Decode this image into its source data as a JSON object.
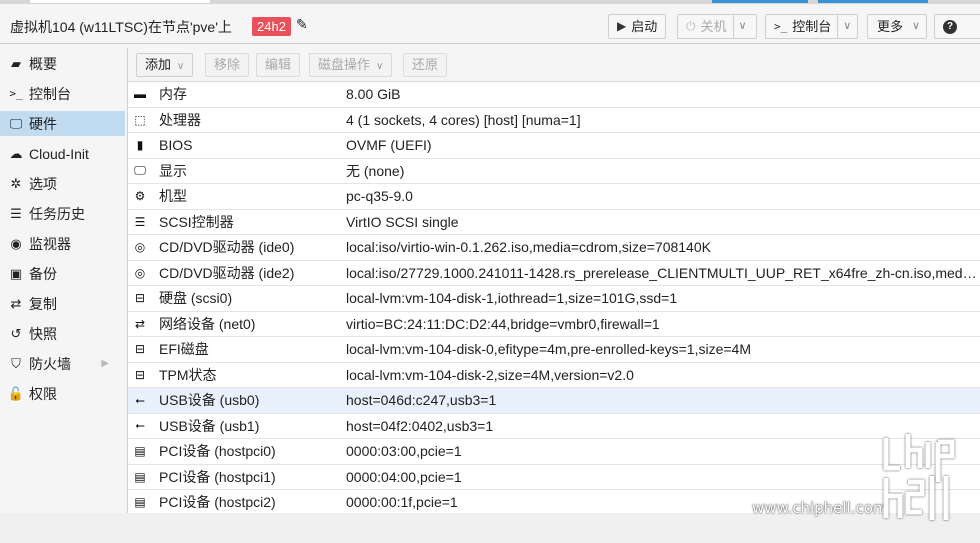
{
  "header": {
    "title": "虚拟机104 (w11LTSC)在节点'pve'上",
    "tag": "24h2",
    "buttons": {
      "start": "启动",
      "shutdown": "关机",
      "console": "控制台",
      "more": "更多"
    }
  },
  "sidebar": {
    "items": [
      {
        "label": "概要",
        "icon": "book-icon"
      },
      {
        "label": "控制台",
        "icon": "terminal-icon"
      },
      {
        "label": "硬件",
        "icon": "desktop-icon"
      },
      {
        "label": "Cloud-Init",
        "icon": "cloud-icon"
      },
      {
        "label": "选项",
        "icon": "gear-icon"
      },
      {
        "label": "任务历史",
        "icon": "list-icon"
      },
      {
        "label": "监视器",
        "icon": "eye-icon"
      },
      {
        "label": "备份",
        "icon": "floppy-icon"
      },
      {
        "label": "复制",
        "icon": "retweet-icon"
      },
      {
        "label": "快照",
        "icon": "history-icon"
      },
      {
        "label": "防火墙",
        "icon": "shield-icon"
      },
      {
        "label": "权限",
        "icon": "unlock-icon"
      }
    ],
    "active_index": 2
  },
  "toolbar": {
    "add": "添加",
    "remove": "移除",
    "edit": "编辑",
    "disk_action": "磁盘操作",
    "revert": "还原"
  },
  "hardware": [
    {
      "icon": "memory-icon",
      "key": "内存",
      "value": "8.00 GiB"
    },
    {
      "icon": "cpu-icon",
      "key": "处理器",
      "value": "4 (1 sockets, 4 cores) [host] [numa=1]"
    },
    {
      "icon": "bios-icon",
      "key": "BIOS",
      "value": "OVMF (UEFI)"
    },
    {
      "icon": "display-icon",
      "key": "显示",
      "value": "无 (none)"
    },
    {
      "icon": "cogs-icon",
      "key": "机型",
      "value": "pc-q35-9.0"
    },
    {
      "icon": "database-icon",
      "key": "SCSI控制器",
      "value": "VirtIO SCSI single"
    },
    {
      "icon": "cdrom-icon",
      "key": "CD/DVD驱动器 (ide0)",
      "value": "local:iso/virtio-win-0.1.262.iso,media=cdrom,size=708140K"
    },
    {
      "icon": "cdrom-icon",
      "key": "CD/DVD驱动器 (ide2)",
      "value": "local:iso/27729.1000.241011-1428.rs_prerelease_CLIENTMULTI_UUP_RET_x64fre_zh-cn.iso,media=…"
    },
    {
      "icon": "hdd-icon",
      "key": "硬盘 (scsi0)",
      "value": "local-lvm:vm-104-disk-1,iothread=1,size=101G,ssd=1"
    },
    {
      "icon": "network-icon",
      "key": "网络设备 (net0)",
      "value": "virtio=BC:24:11:DC:D2:44,bridge=vmbr0,firewall=1"
    },
    {
      "icon": "hdd-icon",
      "key": "EFI磁盘",
      "value": "local-lvm:vm-104-disk-0,efitype=4m,pre-enrolled-keys=1,size=4M"
    },
    {
      "icon": "hdd-icon",
      "key": "TPM状态",
      "value": "local-lvm:vm-104-disk-2,size=4M,version=v2.0"
    },
    {
      "icon": "usb-icon",
      "key": "USB设备 (usb0)",
      "value": "host=046d:c247,usb3=1"
    },
    {
      "icon": "usb-icon",
      "key": "USB设备 (usb1)",
      "value": "host=04f2:0402,usb3=1"
    },
    {
      "icon": "pci-icon",
      "key": "PCI设备 (hostpci0)",
      "value": "0000:03:00,pcie=1"
    },
    {
      "icon": "pci-icon",
      "key": "PCI设备 (hostpci1)",
      "value": "0000:04:00,pcie=1"
    },
    {
      "icon": "pci-icon",
      "key": "PCI设备 (hostpci2)",
      "value": "0000:00:1f,pcie=1"
    }
  ],
  "selected_row": 12,
  "watermark": {
    "site": "www.chiphell.com",
    "logo_text": "chip hell"
  }
}
